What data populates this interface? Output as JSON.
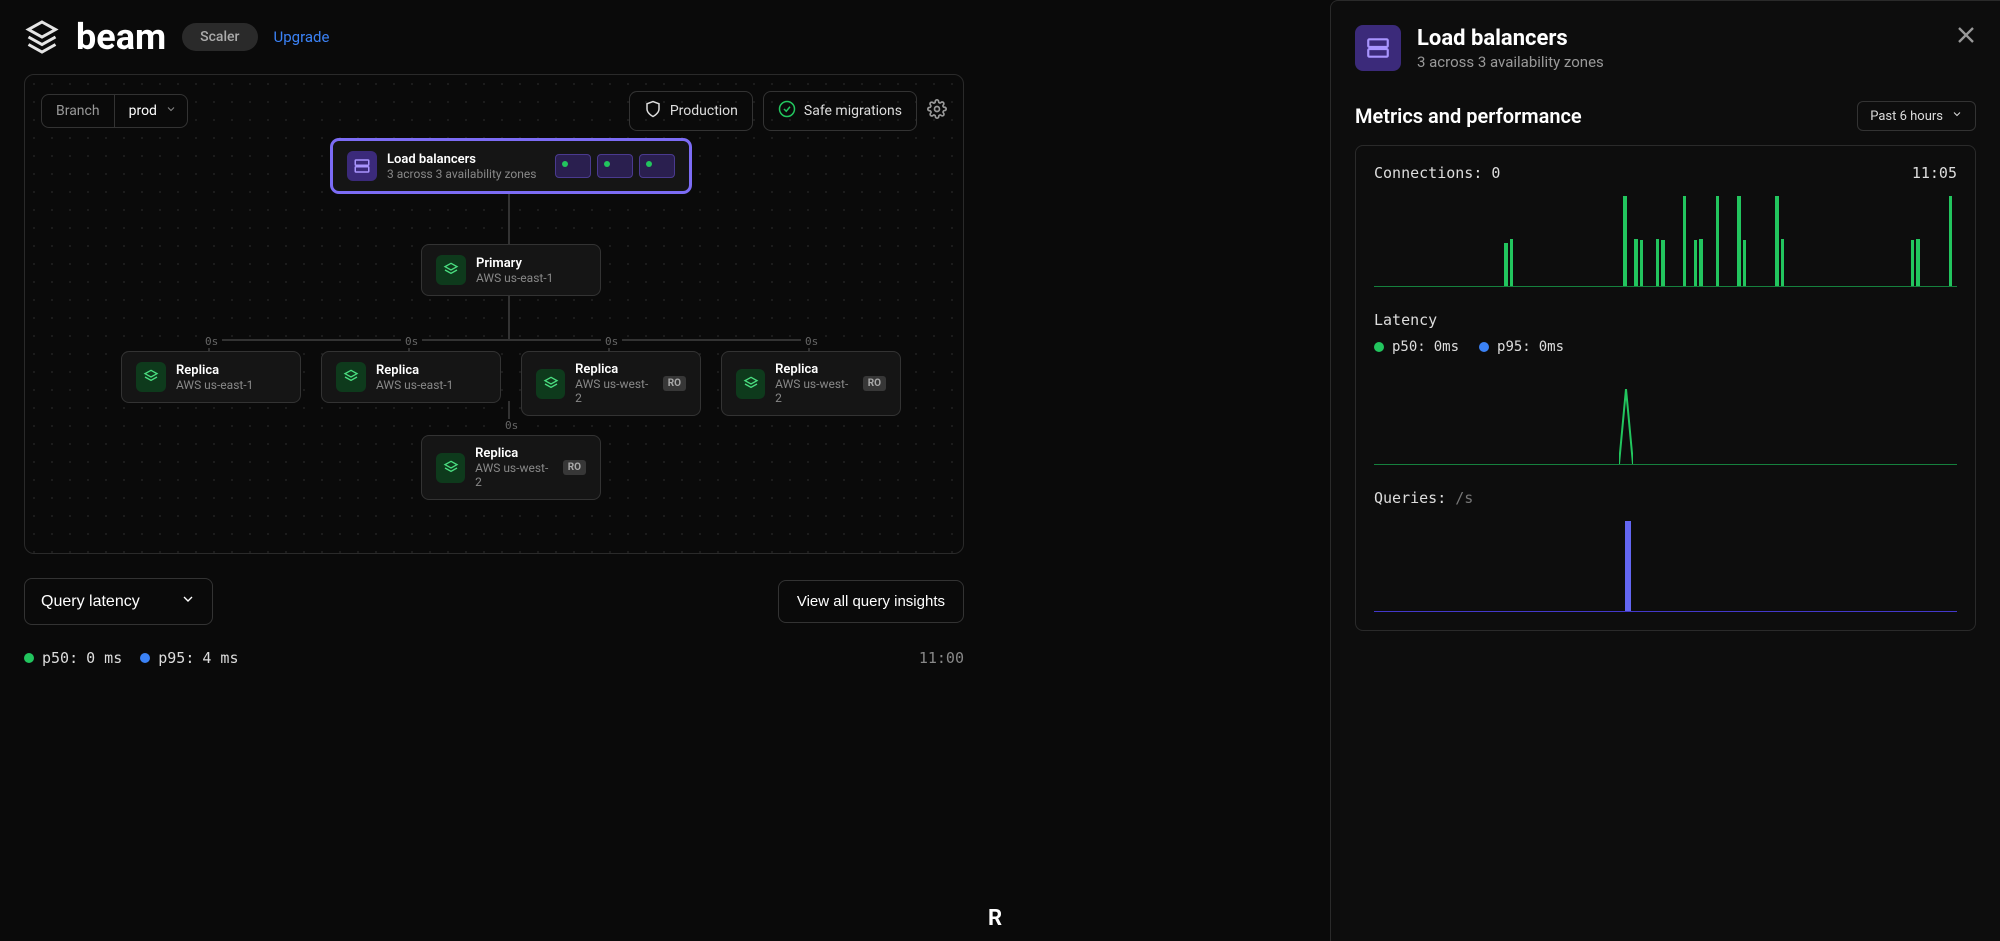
{
  "header": {
    "app_name": "beam",
    "tier_badge": "Scaler",
    "upgrade_label": "Upgrade"
  },
  "topology": {
    "branch_label": "Branch",
    "branch_value": "prod",
    "production_tag": "Production",
    "safe_migrations_tag": "Safe migrations",
    "load_balancer": {
      "title": "Load balancers",
      "subtitle": "3 across 3 availability zones",
      "pod_count": 3
    },
    "primary": {
      "title": "Primary",
      "subtitle": "AWS us-east-1"
    },
    "replicas": [
      {
        "title": "Replica",
        "subtitle": "AWS us-east-1",
        "ro": false,
        "latency": "0s"
      },
      {
        "title": "Replica",
        "subtitle": "AWS us-east-1",
        "ro": false,
        "latency": "0s"
      },
      {
        "title": "Replica",
        "subtitle": "AWS us-west-2",
        "ro": true,
        "latency": "0s"
      },
      {
        "title": "Replica",
        "subtitle": "AWS us-west-2",
        "ro": true,
        "latency": "0s"
      }
    ],
    "extra_replica": {
      "title": "Replica",
      "subtitle": "AWS us-west-2",
      "ro": true,
      "latency": "0s"
    },
    "ro_label": "RO"
  },
  "query_latency": {
    "button_label": "Query latency",
    "view_all_label": "View all query insights",
    "p50_label": "p50:",
    "p50_value": "0 ms",
    "p95_label": "p95:",
    "p95_value": "4 ms",
    "time": "11:00"
  },
  "replicas_heading": "R",
  "panel": {
    "title": "Load balancers",
    "subtitle": "3 across 3 availability zones",
    "metrics_heading": "Metrics and performance",
    "time_range": "Past 6 hours",
    "connections": {
      "label": "Connections:",
      "value": "0",
      "time": "11:05"
    },
    "latency": {
      "label": "Latency",
      "p50_label": "p50:",
      "p50_value": "0ms",
      "p95_label": "p95:",
      "p95_value": "0ms"
    },
    "queries": {
      "label": "Queries:",
      "unit": "/s"
    }
  },
  "chart_data": [
    {
      "type": "bar",
      "title": "Connections",
      "ylabel": "connections",
      "ylim": [
        0,
        100
      ],
      "x_range_hours": 6,
      "values": [
        0,
        0,
        0,
        0,
        0,
        0,
        0,
        0,
        0,
        0,
        0,
        0,
        0,
        0,
        0,
        0,
        0,
        0,
        0,
        0,
        0,
        0,
        0,
        0,
        45,
        50,
        0,
        0,
        0,
        0,
        0,
        0,
        0,
        0,
        0,
        0,
        0,
        0,
        0,
        0,
        0,
        0,
        0,
        0,
        0,
        0,
        95,
        0,
        50,
        48,
        0,
        0,
        50,
        48,
        0,
        0,
        0,
        95,
        0,
        48,
        50,
        0,
        0,
        95,
        0,
        0,
        0,
        95,
        48,
        0,
        0,
        0,
        0,
        0,
        95,
        50,
        0,
        0,
        0,
        0,
        0,
        0,
        0,
        0,
        0,
        0,
        0,
        0,
        0,
        0,
        0,
        0,
        0,
        0,
        0,
        0,
        0,
        0,
        0,
        48,
        50,
        0,
        0,
        0,
        0,
        0,
        95,
        0
      ]
    },
    {
      "type": "line",
      "title": "Latency",
      "ylabel": "ms",
      "ylim": [
        0,
        100
      ],
      "x_range_hours": 6,
      "series": [
        {
          "name": "p50",
          "values": [
            0,
            0,
            0,
            0,
            0,
            0,
            0,
            0,
            0,
            0,
            0,
            0,
            0,
            0,
            0,
            0,
            0,
            0,
            0,
            0,
            0,
            0,
            0,
            0,
            0,
            0,
            0,
            0,
            0,
            0,
            0,
            0,
            0,
            0,
            0,
            0,
            0,
            0,
            0,
            0,
            0,
            0,
            0,
            0,
            0,
            0,
            0,
            0,
            0,
            0,
            0,
            0,
            0,
            0,
            0,
            0,
            0,
            0,
            0,
            0,
            0,
            0,
            0,
            0,
            0,
            0,
            0,
            0,
            0,
            0,
            0,
            0,
            0,
            0,
            0,
            0,
            0,
            0,
            0,
            0,
            0,
            0,
            0,
            0,
            0,
            0,
            0,
            0,
            0,
            0,
            0,
            0,
            0,
            0,
            0,
            0,
            0,
            0,
            0,
            0
          ]
        },
        {
          "name": "p95",
          "values": [
            0,
            0,
            0,
            0,
            0,
            0,
            0,
            0,
            0,
            0,
            0,
            0,
            0,
            0,
            0,
            0,
            0,
            0,
            0,
            0,
            0,
            0,
            0,
            0,
            0,
            0,
            0,
            0,
            0,
            0,
            0,
            0,
            0,
            0,
            0,
            0,
            0,
            0,
            0,
            0,
            0,
            0,
            80,
            0,
            0,
            0,
            0,
            0,
            0,
            0,
            0,
            0,
            0,
            0,
            0,
            0,
            0,
            0,
            0,
            0,
            0,
            0,
            0,
            0,
            0,
            0,
            0,
            0,
            0,
            0,
            0,
            0,
            0,
            0,
            0,
            0,
            0,
            0,
            0,
            0,
            0,
            0,
            0,
            0,
            0,
            0,
            0,
            0,
            0,
            0,
            0,
            0,
            0,
            0,
            0,
            0,
            0,
            0,
            0,
            0
          ]
        }
      ]
    },
    {
      "type": "bar",
      "title": "Queries /s",
      "ylabel": "queries/s",
      "ylim": [
        0,
        100
      ],
      "x_range_hours": 6,
      "values": [
        0,
        0,
        0,
        0,
        0,
        0,
        0,
        0,
        0,
        0,
        0,
        0,
        0,
        0,
        0,
        0,
        0,
        0,
        0,
        0,
        0,
        0,
        0,
        0,
        0,
        0,
        0,
        0,
        0,
        0,
        0,
        0,
        0,
        0,
        0,
        0,
        0,
        0,
        0,
        0,
        0,
        0,
        0,
        95,
        0,
        0,
        0,
        0,
        0,
        0,
        0,
        0,
        0,
        0,
        0,
        0,
        0,
        0,
        0,
        0,
        0,
        0,
        0,
        0,
        0,
        0,
        0,
        0,
        0,
        0,
        0,
        0,
        0,
        0,
        0,
        0,
        0,
        0,
        0,
        0,
        0,
        0,
        0,
        0,
        0,
        0,
        0,
        0,
        0,
        0,
        0,
        0,
        0,
        0,
        0,
        0,
        0,
        0,
        0,
        0
      ]
    }
  ]
}
